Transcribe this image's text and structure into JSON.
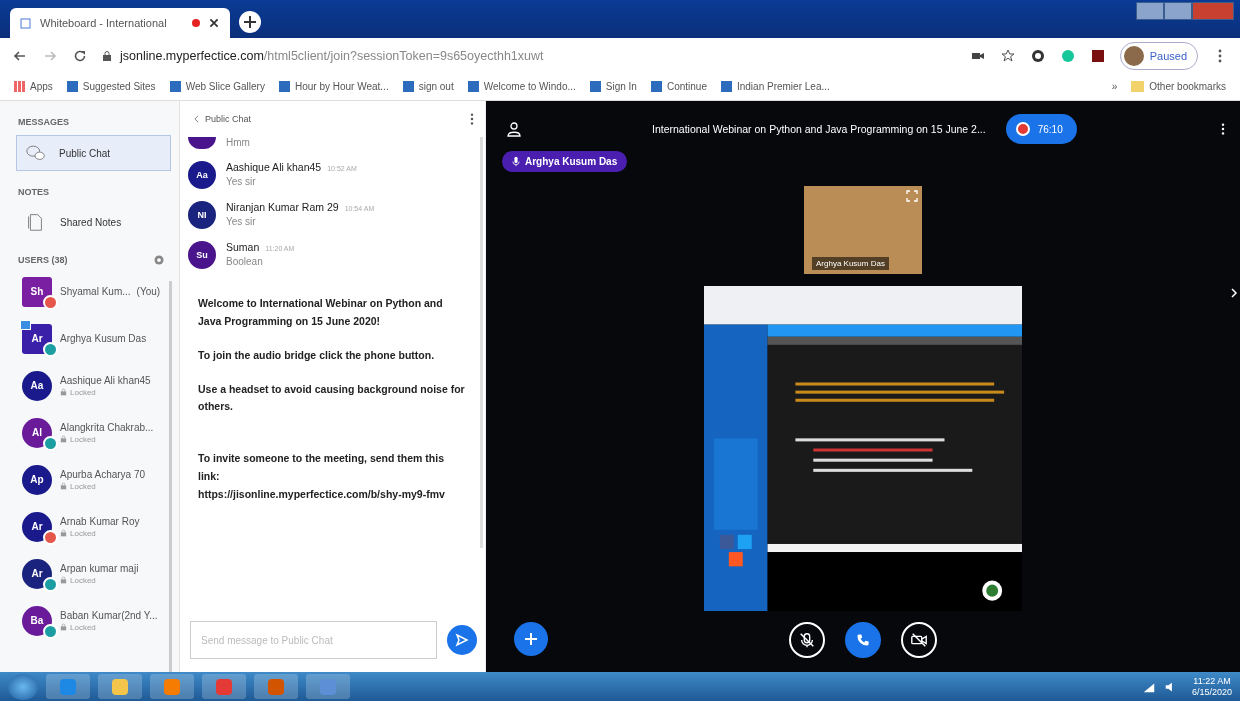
{
  "browser": {
    "tab": {
      "title": "Whiteboard - International",
      "recording": true
    },
    "url_host": "jsonline.myperfectice.com",
    "url_path": "/html5client/join?sessionToken=9s65oyecthh1xuwt",
    "profile": "Paused",
    "bookmarks": [
      "Apps",
      "Suggested Sites",
      "Web Slice Gallery",
      "Hour by Hour Weat...",
      "sign out",
      "Welcome to Windo...",
      "Sign In",
      "Continue",
      "Indian Premier Lea..."
    ],
    "more": "»",
    "other_bookmarks": "Other bookmarks"
  },
  "sidebar": {
    "messages_heading": "MESSAGES",
    "public_chat": {
      "label": "Public Chat",
      "selected": true
    },
    "notes_heading": "NOTES",
    "shared_notes": "Shared Notes",
    "users_heading": "USERS (38)",
    "users": [
      {
        "initials": "Sh",
        "name": "Shyamal Kum...",
        "you": "(You)",
        "moderator": true,
        "presenter": false,
        "microphone": true,
        "listen_only": false,
        "color": "#7b1fa2"
      },
      {
        "initials": "Ar",
        "name": "Arghya Kusum Das",
        "moderator": true,
        "presenter": true,
        "microphone": false,
        "listen_only": true,
        "color": "#3a1fa8"
      },
      {
        "initials": "Aa",
        "name": "Aashique Ali khan45",
        "status": "Locked",
        "moderator": false,
        "presenter": false,
        "microphone": false,
        "listen_only": false,
        "color": "#1a1a8c"
      },
      {
        "initials": "Al",
        "name": "Alangkrita Chakrab...",
        "status": "Locked",
        "moderator": false,
        "presenter": false,
        "microphone": false,
        "listen_only": true,
        "color": "#6a1b9a"
      },
      {
        "initials": "Ap",
        "name": "Apurba Acharya 70",
        "status": "Locked",
        "moderator": false,
        "presenter": false,
        "microphone": false,
        "listen_only": false,
        "color": "#1a1a8c"
      },
      {
        "initials": "Ar",
        "name": "Arnab Kumar Roy",
        "status": "Locked",
        "moderator": false,
        "presenter": false,
        "microphone": true,
        "listen_only": false,
        "color": "#1a1a8c"
      },
      {
        "initials": "Ar",
        "name": "Arpan kumar maji",
        "status": "Locked",
        "moderator": false,
        "presenter": false,
        "microphone": false,
        "listen_only": true,
        "color": "#1a237e"
      },
      {
        "initials": "Ba",
        "name": "Baban Kumar(2nd Y...",
        "status": "Locked",
        "moderator": false,
        "presenter": false,
        "microphone": false,
        "listen_only": true,
        "color": "#6a1b9a"
      }
    ]
  },
  "chat": {
    "header": "Public Chat",
    "messages": [
      {
        "text": "Hmm",
        "color": "#4a148c"
      },
      {
        "initials": "Aa",
        "name": "Aashique Ali khan45",
        "time": "10:52 AM",
        "text": "Yes sir",
        "color": "#1a1a8c"
      },
      {
        "initials": "NI",
        "name": "Niranjan Kumar Ram 29",
        "time": "10:54 AM",
        "text": "Yes sir",
        "color": "#1a237e"
      },
      {
        "initials": "Su",
        "name": "Suman",
        "time": "11:20 AM",
        "text": "Boolean",
        "color": "#4a148c"
      }
    ],
    "welcome": [
      "Welcome to International Webinar on Python and Java Programming on 15 June 2020!",
      "To join the audio bridge click the phone button.",
      "Use a headset to avoid causing background noise for others."
    ],
    "invite": "To invite someone to the meeting, send them this link:",
    "link": "https://jisonline.myperfectice.com/b/shy-my9-fmv",
    "placeholder": "Send message to Public Chat"
  },
  "main": {
    "title": "International Webinar on Python and Java Programming on 15 June 2...",
    "recording": {
      "on": true,
      "time": "76:10"
    },
    "talker": "Arghya Kusum Das",
    "webcam_label": "Arghya Kusum Das",
    "controls": [
      {
        "kind": "microphone",
        "active": false
      },
      {
        "kind": "phone",
        "active": true
      },
      {
        "kind": "camera",
        "active": false
      }
    ]
  },
  "taskbar": {
    "time": "11:22 AM",
    "date": "6/15/2020"
  }
}
